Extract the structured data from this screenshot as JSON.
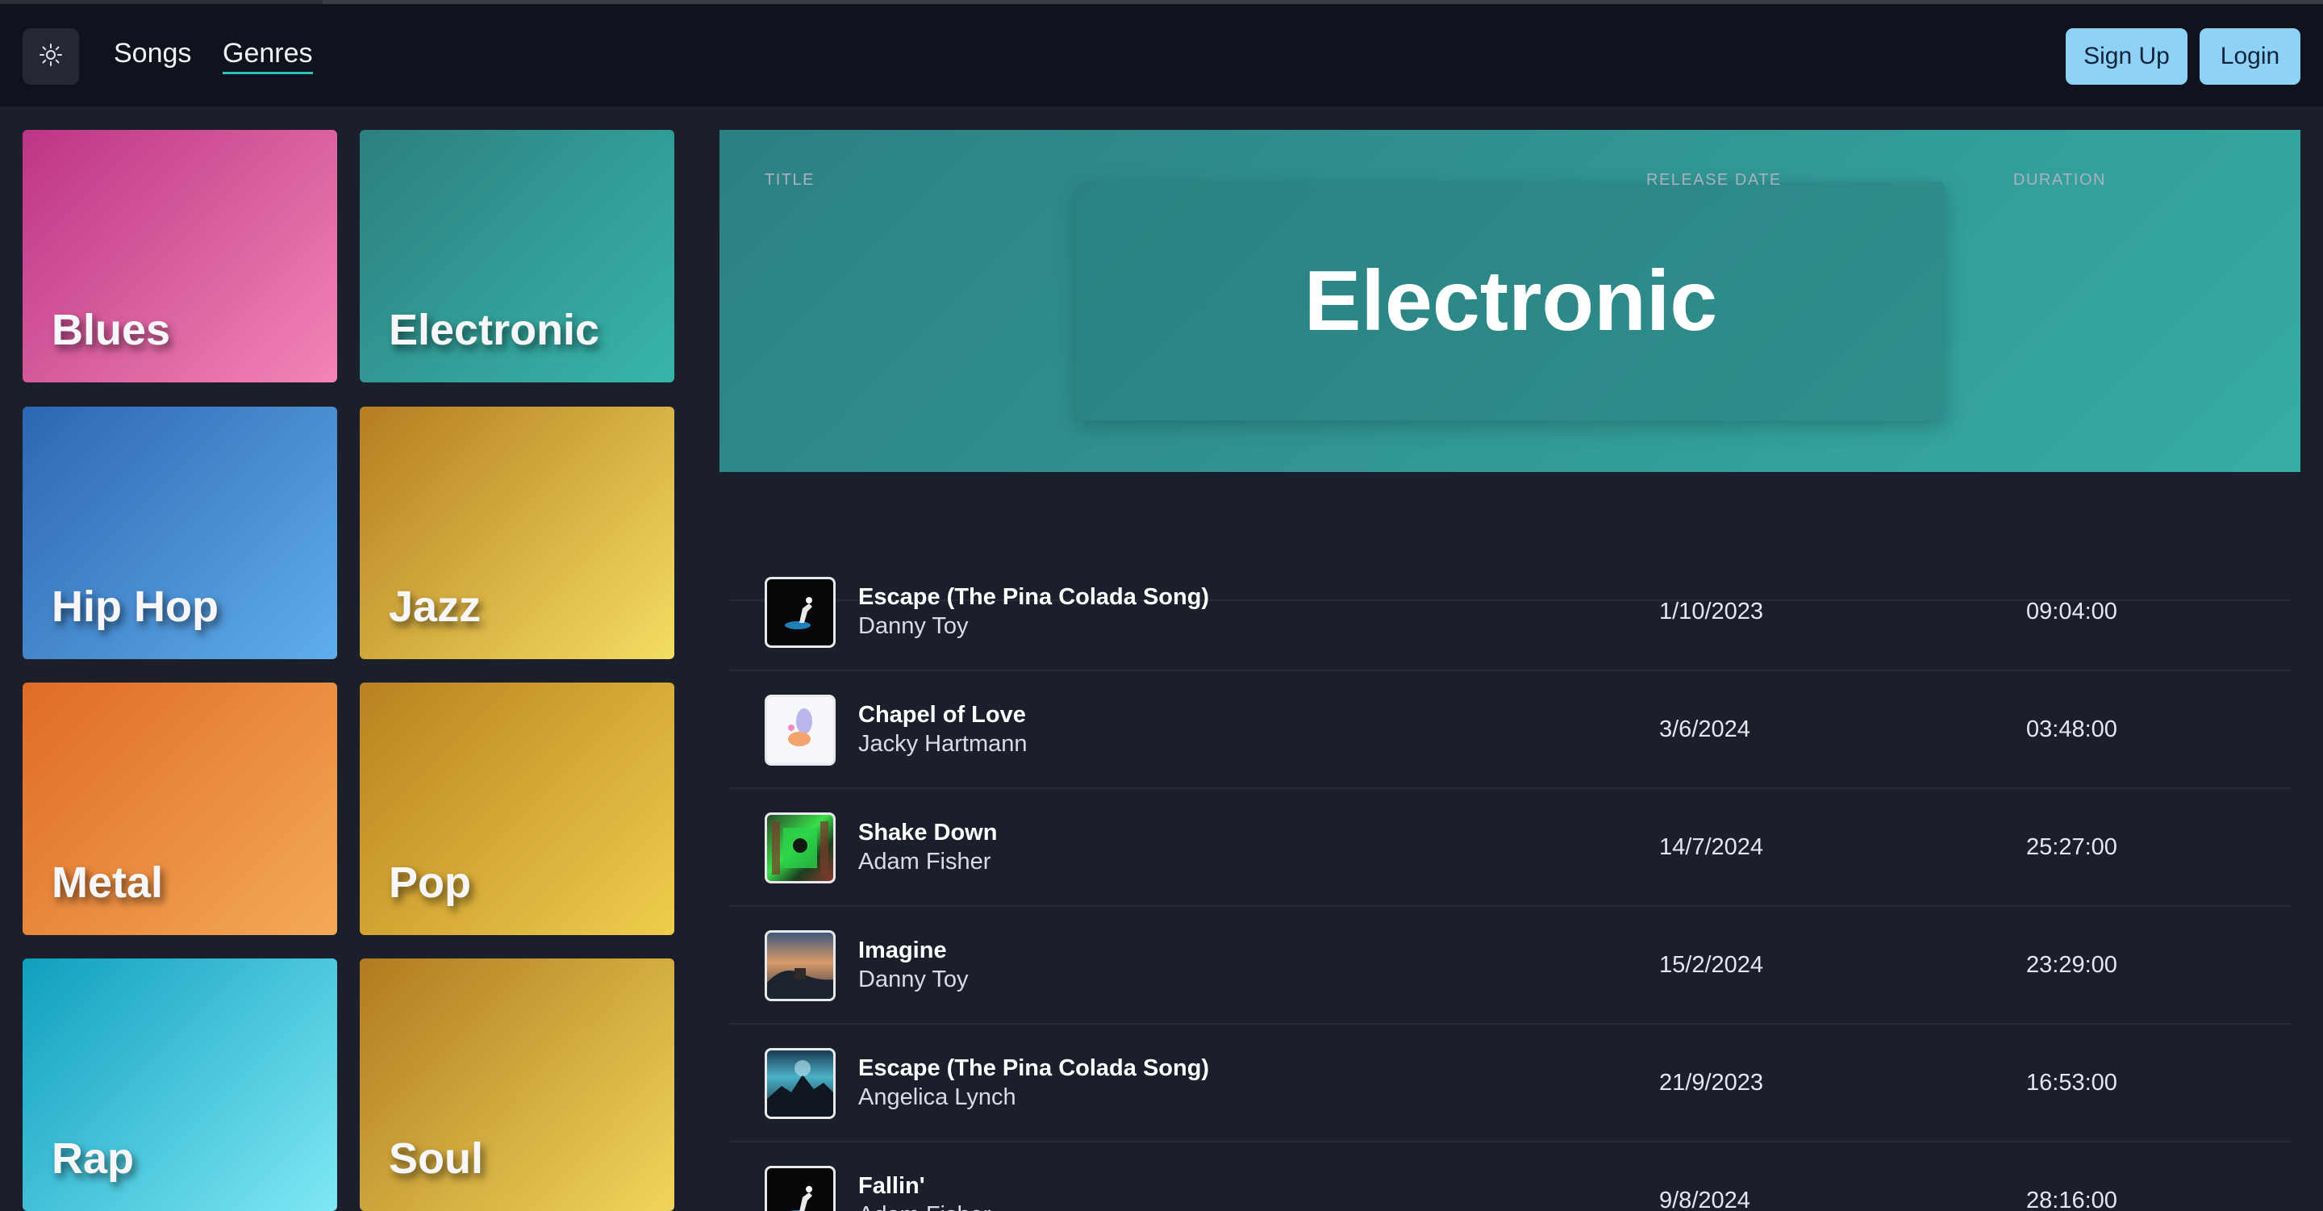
{
  "navbar": {
    "theme_icon": "sun-icon",
    "links": {
      "songs": "Songs",
      "genres": "Genres"
    },
    "signup_label": "Sign Up",
    "login_label": "Login",
    "accent_color": "#33c0b4",
    "button_color": "#8fd1f7"
  },
  "genres": [
    {
      "name": "Blues",
      "colors": [
        "#bd3585",
        "#f385b7"
      ]
    },
    {
      "name": "Electronic",
      "colors": [
        "#2d7f7f",
        "#37b5aa"
      ]
    },
    {
      "name": "Hip Hop",
      "colors": [
        "#2d66b3",
        "#60aeeb"
      ]
    },
    {
      "name": "Jazz",
      "colors": [
        "#b57d1f",
        "#f3dd63"
      ]
    },
    {
      "name": "Metal",
      "colors": [
        "#df6b26",
        "#f4aa58"
      ]
    },
    {
      "name": "Pop",
      "colors": [
        "#b8821f",
        "#efcd4d"
      ]
    },
    {
      "name": "Rap",
      "colors": [
        "#109fbf",
        "#7fe8f5"
      ]
    },
    {
      "name": "Soul",
      "colors": [
        "#b07b1f",
        "#f0d55c"
      ]
    }
  ],
  "hero": {
    "title": "Electronic"
  },
  "table": {
    "columns": {
      "title": "TITLE",
      "release_date": "RELEASE DATE",
      "duration": "DURATION"
    },
    "rows": [
      {
        "title": "Escape (The Pina Colada Song)",
        "artist": "Danny Toy",
        "release_date": "1/10/2023",
        "duration": "09:04:00",
        "artwork": "album-art-dark"
      },
      {
        "title": "Chapel of Love",
        "artist": "Jacky Hartmann",
        "release_date": "3/6/2024",
        "duration": "03:48:00",
        "artwork": "album-art-pastel"
      },
      {
        "title": "Shake Down",
        "artist": "Adam Fisher",
        "release_date": "14/7/2024",
        "duration": "25:27:00",
        "artwork": "album-art-green"
      },
      {
        "title": "Imagine",
        "artist": "Danny Toy",
        "release_date": "15/2/2024",
        "duration": "23:29:00",
        "artwork": "album-art-sunset"
      },
      {
        "title": "Escape (The Pina Colada Song)",
        "artist": "Angelica Lynch",
        "release_date": "21/9/2023",
        "duration": "16:53:00",
        "artwork": "album-art-storm"
      },
      {
        "title": "Fallin'",
        "artist": "Adam Fisher",
        "release_date": "9/8/2024",
        "duration": "28:16:00",
        "artwork": "album-art-dark"
      }
    ]
  }
}
